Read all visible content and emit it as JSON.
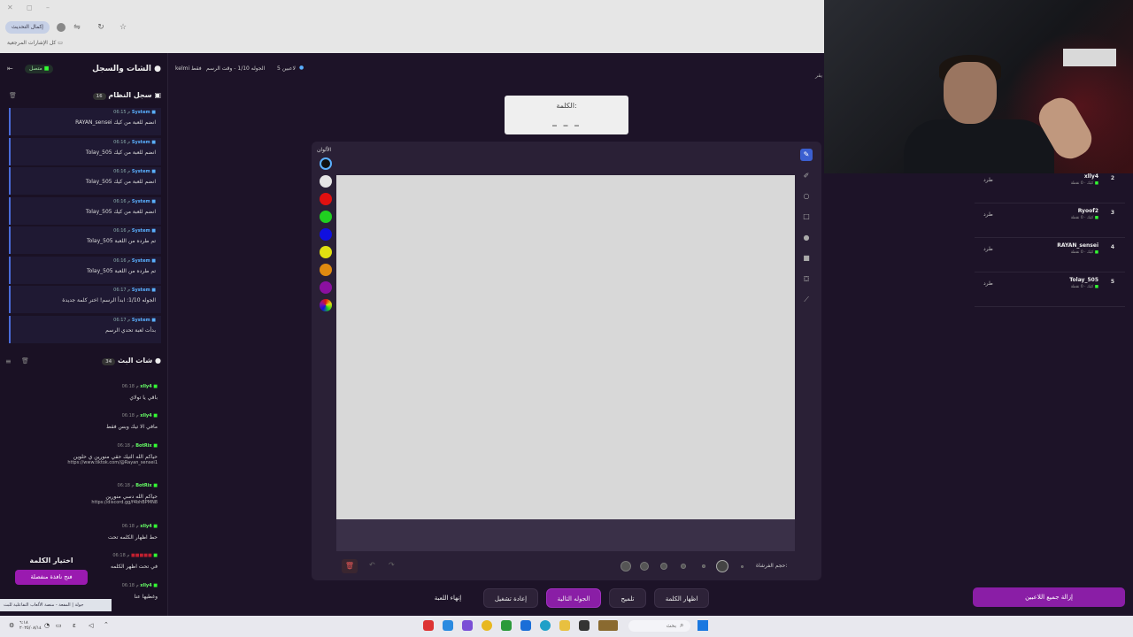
{
  "browser": {
    "sync_button": "إكمال التحديث",
    "bookmarks_label": "كل الإشارات المرجعية"
  },
  "left_panel": {
    "title": "الشات والسجل",
    "connected": "متصل",
    "system_log": {
      "title": "سجل النظام",
      "count": "16",
      "entries": [
        {
          "sender": "System",
          "time": "06:15 م",
          "text": "RAYAN_sensei انضم للعبة من كيك"
        },
        {
          "sender": "System",
          "time": "06:16 م",
          "text": "Tolay_505 انضم للعبة من كيك"
        },
        {
          "sender": "System",
          "time": "06:16 م",
          "text": "Tolay_505 انضم للعبة من كيك"
        },
        {
          "sender": "System",
          "time": "06:16 م",
          "text": "Tolay_505 انضم للعبة من كيك"
        },
        {
          "sender": "System",
          "time": "06:16 م",
          "text": "Tolay_505 تم طرده من اللعبة"
        },
        {
          "sender": "System",
          "time": "06:16 م",
          "text": "Tolay_505 تم طرده من اللعبة"
        },
        {
          "sender": "System",
          "time": "06:17 م",
          "text": "الجوله 1/10: ابدأ الرسم! اختر كلمة جديدة"
        },
        {
          "sender": "System",
          "time": "06:17 م",
          "text": "بدأت لعبة تحدي الرسم"
        }
      ]
    },
    "live_chat": {
      "title": "شات البث",
      "count": "34",
      "messages": [
        {
          "user": "xlly4",
          "time": "06:18 م",
          "text": "باقي يا تولاي",
          "link": ""
        },
        {
          "user": "xlly4",
          "time": "06:18 م",
          "text": "مافي الا تيك وبس فقط",
          "link": ""
        },
        {
          "user": "BotRix",
          "time": "06:18 م",
          "text": "حياكم الله التيك حقي منورين ي حلوين",
          "link": "https://www.tiktok.com/@Rayan_sensei1"
        },
        {
          "user": "BotRix",
          "time": "06:18 م",
          "text": "حياكم الله دسي منورين",
          "link": "https://discord.gg/f4bhBPMN8"
        },
        {
          "user": "xlly4",
          "time": "06:18 م",
          "text": "حط اظهار الكلمه تحت",
          "link": ""
        },
        {
          "user": "■■■■■",
          "time": "06:18 م",
          "text": "في تحت اظهر الكلمه",
          "link": ""
        },
        {
          "user": "xlly4",
          "time": "06:18 م",
          "text": "وغطيها عنا",
          "link": ""
        }
      ]
    },
    "pick_word": {
      "title": "اختيار الكلمة",
      "button": "فتح نافذة منفصلة"
    },
    "tooltip": "جولة | المفعة - منصة الألعاب التفاعلية للبث"
  },
  "game": {
    "status": {
      "players": "5 لاعبين",
      "round": "الجوله 1/10 - وقت الرسم",
      "mode": "kelmi فقط"
    },
    "word_label": "الكلمة:",
    "word_value": "_ _ _",
    "colors_label": "الألوان",
    "colors": [
      "#111111",
      "#e6e6e6",
      "#e01010",
      "#20d020",
      "#1010e0",
      "#e0e010",
      "#e08a10",
      "#8a10a0",
      "multi"
    ],
    "brush_label": "حجم الفرشاة:",
    "buttons": {
      "end": "إنهاء اللعبة",
      "restart": "إعادة تشغيل",
      "next": "الجوله التالية",
      "hint": "تلميح",
      "reveal": "اظهار الكلمة"
    }
  },
  "players_panel": {
    "kick": "طرد",
    "players": [
      {
        "rank": "2",
        "name": "xlly4",
        "sub": "كيك · 0 نقطة"
      },
      {
        "rank": "3",
        "name": "Ryoof2",
        "sub": "كيك · 0 نقطة"
      },
      {
        "rank": "4",
        "name": "RAYAN_sensei",
        "sub": "كيك · 0 نقطة"
      },
      {
        "rank": "5",
        "name": "Tolay_505",
        "sub": "كيك · 0 نقطة"
      }
    ],
    "remove_all": "إزالة جميع اللاعبين"
  },
  "taskbar": {
    "search": "بحث",
    "clock_time": "٦:١٨",
    "clock_date": "٢٠٢٥/٠٨/١٤"
  },
  "right_edge": "يقر"
}
